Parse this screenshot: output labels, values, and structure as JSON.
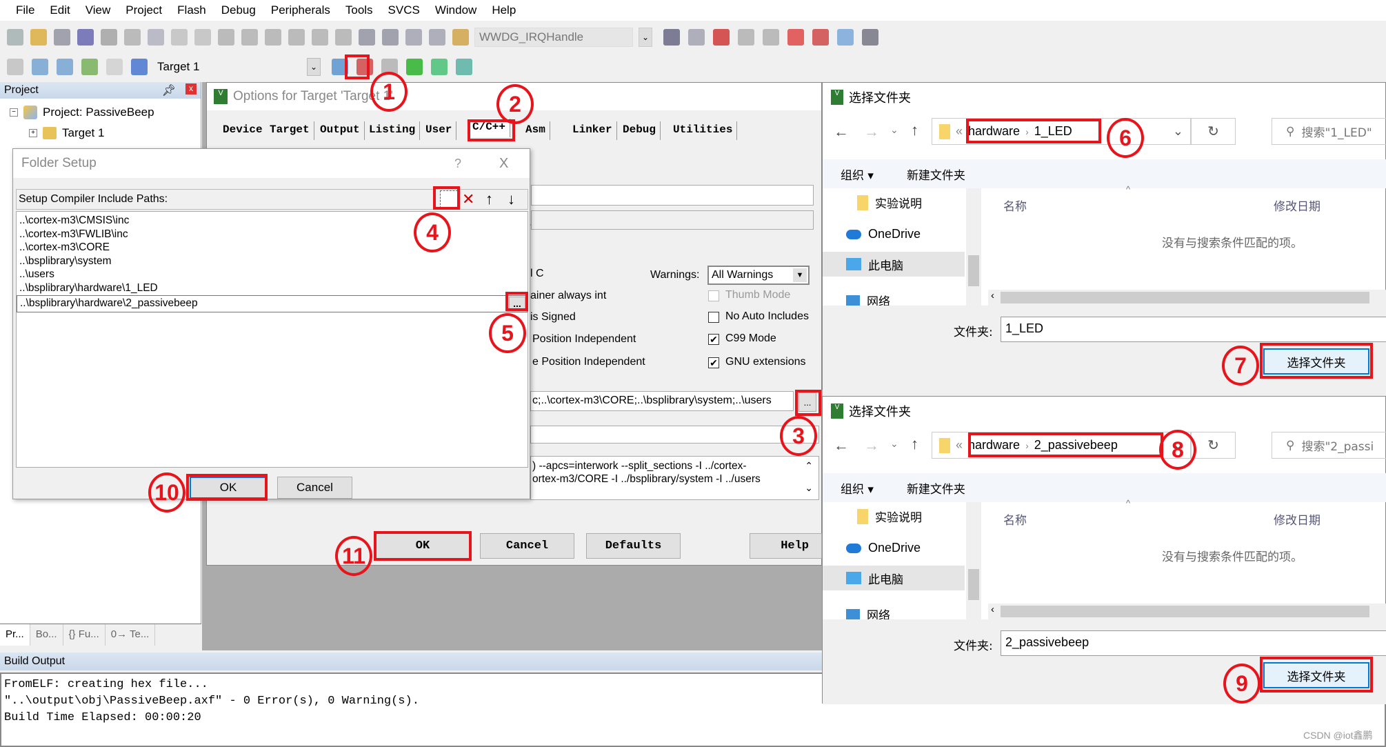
{
  "menu": [
    "File",
    "Edit",
    "View",
    "Project",
    "Flash",
    "Debug",
    "Peripherals",
    "Tools",
    "SVCS",
    "Window",
    "Help"
  ],
  "toolbar1": {
    "icons": [
      "new-file-icon",
      "open-folder-icon",
      "save-icon",
      "save-all-icon",
      "cut-icon",
      "copy-icon",
      "paste-icon",
      "undo-icon",
      "redo-icon",
      "nav-back-icon",
      "nav-forward-icon",
      "bookmark-icon",
      "bookmark-prev-icon",
      "bookmark-next-icon",
      "bookmark-clear-icon",
      "indent-icon",
      "unindent-icon",
      "comment-icon",
      "uncomment-icon",
      "find-in-files-icon"
    ],
    "function_combo": "WWDG_IRQHandle",
    "icons_right": [
      "find-icon",
      "incremental-find-icon",
      "debug-session-icon",
      "breakpoint-icon",
      "breakpoint-disable-icon",
      "breakpoint-kill-icon",
      "erase-icon",
      "window-layout-icon",
      "configure-icon"
    ]
  },
  "toolbar2": {
    "icons": [
      "translate-icon",
      "build-icon",
      "rebuild-icon",
      "batch-build-icon",
      "stop-build-icon",
      "load-icon"
    ],
    "target": "Target 1",
    "icons_right": [
      "options-for-target-icon",
      "manage-project-items-icon",
      "select-packs-icon",
      "manage-rte-icon",
      "rte-filter-icon",
      "pack-installer-icon"
    ]
  },
  "project_panel": {
    "title": "Project",
    "root": "Project: PassiveBeep",
    "child": "Target 1",
    "tabs": [
      "Pr...",
      "Bo...",
      "{} Fu...",
      "0→ Te..."
    ]
  },
  "options_dialog": {
    "title": "Options for Target 'Target 1'",
    "tabs": [
      "Device",
      "Target",
      "Output",
      "Listing",
      "User",
      "C/C++",
      "Asm",
      "Linker",
      "Debug",
      "Utilities"
    ],
    "active_tab": "C/C++",
    "left_labels": [
      "l C",
      "ainer always int",
      "is Signed",
      "Position Independent",
      "e Position Independent"
    ],
    "warnings_label": "Warnings:",
    "warnings_value": "All Warnings",
    "checkboxes": [
      {
        "label": "Thumb Mode",
        "checked": false,
        "disabled": true
      },
      {
        "label": "No Auto Includes",
        "checked": false,
        "disabled": false
      },
      {
        "label": "C99 Mode",
        "checked": true,
        "disabled": false
      },
      {
        "label": "GNU extensions",
        "checked": true,
        "disabled": false
      }
    ],
    "include_paths": "c;..\\cortex-m3\\CORE;..\\bsplibrary\\system;..\\users",
    "browse_label": "...",
    "compiler_control": [
      ") --apcs=interwork --split_sections -I ../cortex-",
      "ortex-m3/CORE -I ../bsplibrary/system -I ../users"
    ],
    "buttons": {
      "ok": "OK",
      "cancel": "Cancel",
      "defaults": "Defaults",
      "help": "Help"
    }
  },
  "folder_setup": {
    "title": "Folder Setup",
    "help": "?",
    "close": "X",
    "header": "Setup Compiler Include Paths:",
    "paths": [
      "..\\cortex-m3\\CMSIS\\inc",
      "..\\cortex-m3\\FWLIB\\inc",
      "..\\cortex-m3\\CORE",
      "..\\bsplibrary\\system",
      "..\\users",
      "..\\bsplibrary\\hardware\\1_LED"
    ],
    "editing_path": "..\\bsplibrary\\hardware\\2_passivebeep",
    "browse_label": "...",
    "ok": "OK",
    "cancel": "Cancel"
  },
  "folder_picker_1": {
    "title": "选择文件夹",
    "breadcrumb_prefix": "«",
    "breadcrumb": [
      "hardware",
      "1_LED"
    ],
    "search_placeholder": "搜索\"1_LED\"",
    "organize": "组织 ▾",
    "new_folder": "新建文件夹",
    "nav_items": [
      "实验说明",
      "OneDrive",
      "此电脑",
      "网络"
    ],
    "selected_nav": "此电脑",
    "col_name": "名称",
    "col_date": "修改日期",
    "empty_text": "没有与搜索条件匹配的项。",
    "folder_label": "文件夹:",
    "folder_value": "1_LED",
    "select_button": "选择文件夹"
  },
  "folder_picker_2": {
    "title": "选择文件夹",
    "breadcrumb_prefix": "«",
    "breadcrumb": [
      "hardware",
      "2_passivebeep"
    ],
    "search_placeholder": "搜索\"2_passi",
    "organize": "组织 ▾",
    "new_folder": "新建文件夹",
    "nav_items": [
      "实验说明",
      "OneDrive",
      "此电脑",
      "网络"
    ],
    "selected_nav": "此电脑",
    "col_name": "名称",
    "col_date": "修改日期",
    "empty_text": "没有与搜索条件匹配的项。",
    "folder_label": "文件夹:",
    "folder_value": "2_passivebeep",
    "select_button": "选择文件夹"
  },
  "build_output": {
    "title": "Build Output",
    "lines": [
      "FromELF: creating hex file...",
      "\"..\\output\\obj\\PassiveBeep.axf\" - 0 Error(s), 0 Warning(s).",
      "Build Time Elapsed:  00:00:20"
    ]
  },
  "annotations": [
    "1",
    "2",
    "3",
    "4",
    "5",
    "6",
    "7",
    "8",
    "9",
    "10",
    "11"
  ],
  "watermark": "CSDN @iot鑫鹏",
  "colors": {
    "annotation_red": "#e8141c",
    "header_blue": "#c9d8ea",
    "select_button_border": "#0078d7"
  }
}
